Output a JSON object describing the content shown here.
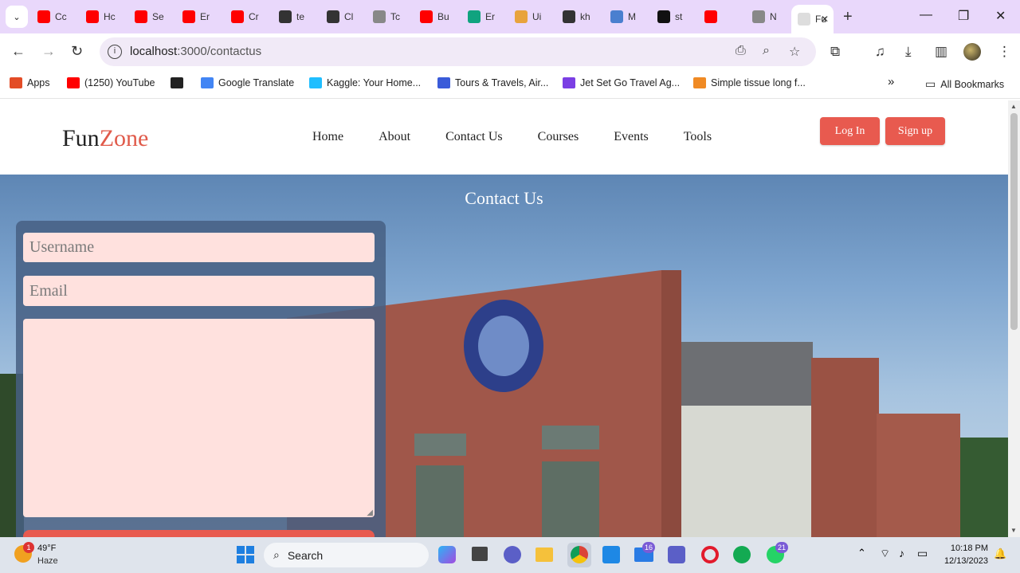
{
  "browser": {
    "tabs": [
      {
        "label": "Cc",
        "color": "#ff0000"
      },
      {
        "label": "Hc",
        "color": "#ff0000"
      },
      {
        "label": "Se",
        "color": "#ff0000"
      },
      {
        "label": "Er",
        "color": "#ff0000"
      },
      {
        "label": "Cr",
        "color": "#ff0000"
      },
      {
        "label": "te",
        "color": "#333333"
      },
      {
        "label": "Cl",
        "color": "#333333"
      },
      {
        "label": "Tc",
        "color": "#888888"
      },
      {
        "label": "Bu",
        "color": "#ff0000"
      },
      {
        "label": "Er",
        "color": "#10a37f"
      },
      {
        "label": "Ui",
        "color": "#e8a33d"
      },
      {
        "label": "kh",
        "color": "#333333"
      },
      {
        "label": "M",
        "color": "#4a7fcf"
      },
      {
        "label": "st",
        "color": "#111111"
      },
      {
        "label": "",
        "color": "#ff0000"
      },
      {
        "label": "N",
        "color": "#888888"
      }
    ],
    "active_tab": {
      "label": "Fu",
      "close": "✕"
    },
    "new_tab": "+",
    "window_controls": {
      "minimize": "—",
      "maximize": "❐",
      "close": "✕"
    },
    "address": {
      "host": "localhost",
      "path": ":3000/contactus"
    },
    "bookmarks": [
      {
        "label": "Apps",
        "color": "#e34c26"
      },
      {
        "label": "(1250) YouTube",
        "color": "#ff0000"
      },
      {
        "label": "",
        "color": "#222222"
      },
      {
        "label": "Google Translate",
        "color": "#4285f4"
      },
      {
        "label": "Kaggle: Your Home...",
        "color": "#20beff"
      },
      {
        "label": "Tours & Travels, Air...",
        "color": "#3a5bd9"
      },
      {
        "label": "Jet Set Go Travel Ag...",
        "color": "#7b3fe4"
      },
      {
        "label": "Simple tissue long f...",
        "color": "#f08a24"
      }
    ],
    "bookmarks_overflow": "»",
    "all_bookmarks": "All Bookmarks"
  },
  "site": {
    "logo_part1": "Fun",
    "logo_part2": "Zone",
    "nav": [
      "Home",
      "About",
      "Contact Us",
      "Courses",
      "Events",
      "Tools"
    ],
    "login_label": "Log In",
    "signup_label": "Sign up",
    "hero_title": "Contact Us",
    "form": {
      "username_placeholder": "Username",
      "email_placeholder": "Email"
    },
    "accent_color": "#e85a4f"
  },
  "taskbar": {
    "weather_temp": "49°F",
    "weather_desc": "Haze",
    "weather_badge": "1",
    "search_label": "Search",
    "badges": {
      "mail": "16",
      "whatsapp": "21"
    },
    "time": "10:18 PM",
    "date": "12/13/2023"
  }
}
